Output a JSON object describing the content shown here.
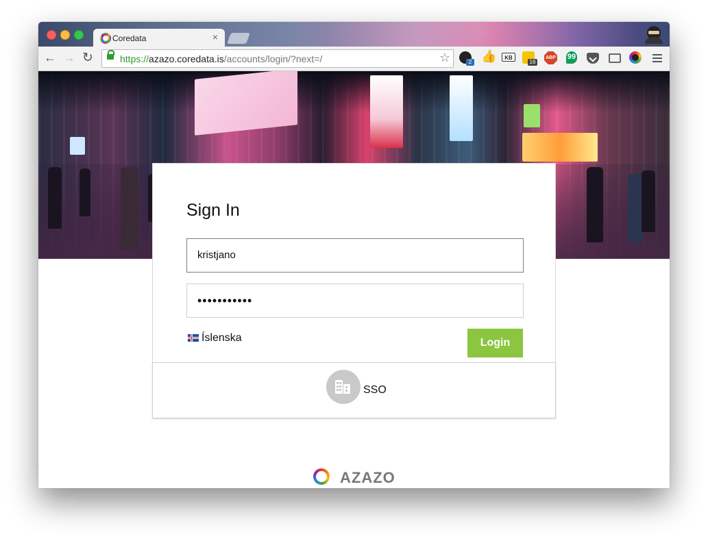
{
  "browser": {
    "tab": {
      "title": "Coredata",
      "close_label": "×"
    },
    "toolbar": {
      "back_label": "←",
      "forward_label": "→",
      "reload_label": "↻",
      "url_scheme": "https://",
      "url_host": "azazo.coredata.is",
      "url_path": "/accounts/login/?next=/",
      "star_label": "☆"
    },
    "extensions": {
      "github_badge": "2",
      "kb_label": "KB",
      "ldr_badge": "16",
      "abp_label": "ABP",
      "hangouts_label": "99"
    }
  },
  "login": {
    "title": "Sign In",
    "username_value": "kristjano",
    "password_value": "•••••••••••",
    "language_label": "Íslenska",
    "login_button": "Login",
    "sso_label": "SSO"
  },
  "footer": {
    "brand_name": "AZAZO"
  },
  "colors": {
    "login_button": "#8cc540",
    "sso_circle": "#c9c9c9",
    "secure_url": "#2e9b2e"
  }
}
